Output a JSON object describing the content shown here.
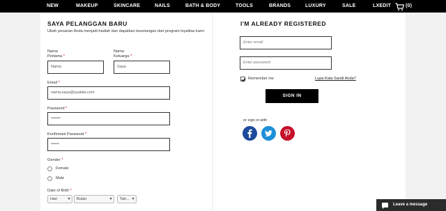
{
  "nav": {
    "items": [
      "NEW",
      "MAKEUP",
      "SKINCARE",
      "NAILS",
      "BATH & BODY",
      "TOOLS",
      "BRANDS",
      "LUXURY",
      "SALE",
      "LXEDIT"
    ],
    "cart_count": "(0)"
  },
  "register": {
    "title": "SAYA PELANGGAN BARU",
    "subtitle": "Ubah pesanan Anda menjadi hadiah dan dapatkan keuntungan dari program loyalitas kami",
    "first_name_label_1": "Nama",
    "first_name_label_2": "Pertama",
    "first_name_value": "Nama",
    "last_name_label_1": "Nama",
    "last_name_label_2": "Keluarga",
    "last_name_value": "Saya",
    "email_label": "Email",
    "email_value": "nama.saya@syalala.com",
    "password_label": "Password",
    "password_value": "•••••••",
    "confirm_password_label": "Konfirmasi Password",
    "confirm_password_value": "••••••",
    "gender_label": "Gender",
    "gender_options": [
      "Female",
      "Male"
    ],
    "dob_label": "Date of Birth",
    "dob_day": "Hari",
    "dob_month": "Bulan",
    "dob_year": "Tah..."
  },
  "login": {
    "title": "I'M ALREADY REGISTERED",
    "email_placeholder": "Enter email",
    "password_placeholder": "Enter password",
    "remember_me": "Remember me",
    "forgot_password": "Lupa Kata Sandi Anda?",
    "sign_in_button": "SIGN IN",
    "social_label": "or sign in with"
  },
  "chat": {
    "label": "Leave a message"
  },
  "colors": {
    "facebook": "#1d4a9b",
    "twitter": "#1d8fd8",
    "pinterest": "#c5102a",
    "required": "#d0021b"
  }
}
